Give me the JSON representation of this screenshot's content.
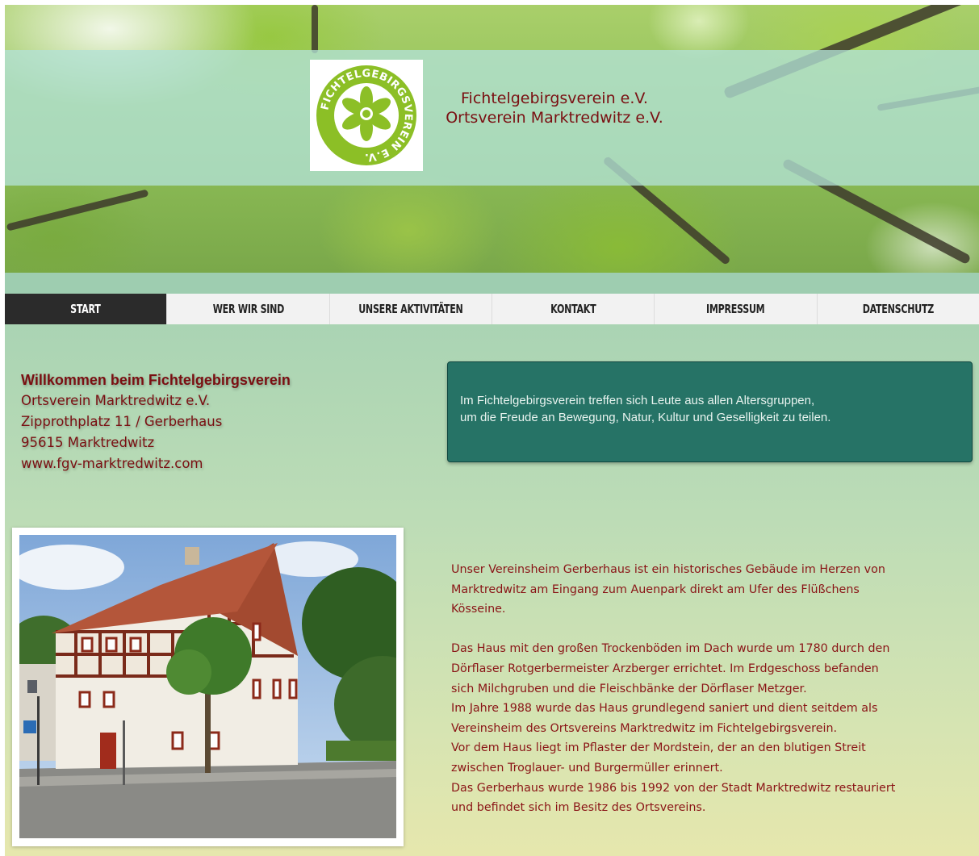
{
  "header": {
    "logo_text": "FICHTELGEBIRGSVEREIN E.V.",
    "org_line1": "Fichtelgebirgsverein e.V.",
    "org_line2": "Ortsverein Marktredwitz e.V."
  },
  "nav": {
    "items": [
      {
        "label": "START",
        "active": true
      },
      {
        "label": "WER WIR SIND",
        "active": false
      },
      {
        "label": "UNSERE AKTIVITÄTEN",
        "active": false
      },
      {
        "label": "KONTAKT",
        "active": false
      },
      {
        "label": "IMPRESSUM",
        "active": false
      },
      {
        "label": "DATENSCHUTZ",
        "active": false
      }
    ]
  },
  "welcome": {
    "title": "Willkommen beim Fichtelgebirgsverein",
    "lines": [
      "Ortsverein Marktredwitz e.V.",
      "Zipprothplatz 11 / Gerberhaus",
      "95615 Marktredwitz",
      "www.fgv-marktredwitz.com"
    ]
  },
  "info_box": {
    "lines": [
      "Im Fichtelgebirgsverein treffen sich Leute aus allen Altersgruppen,",
      "um die Freude an Bewegung, Natur, Kultur und Geselligkeit zu teilen."
    ]
  },
  "description": {
    "para1": [
      "Unser Vereinsheim Gerberhaus ist ein historisches Gebäude im Herzen von",
      "Marktredwitz am Eingang zum Auenpark direkt am Ufer des Flüßchens",
      "Kösseine."
    ],
    "para2": [
      "Das Haus mit den großen Trockenböden im Dach wurde um 1780 durch den",
      "Dörflaser Rotgerbermeister Arzberger errichtet. Im Erdgeschoss befanden",
      "sich Milchgruben und die Fleischbänke der Dörflaser Metzger.",
      "Im Jahre 1988 wurde das Haus grundlegend saniert und dient seitdem als",
      "Vereinsheim des Ortsvereins Marktredwitz im Fichtelgebirgsverein.",
      "Vor dem Haus liegt im Pflaster der Mordstein, der an den blutigen Streit",
      "zwischen Troglauer- und Burgermüller erinnert.",
      "Das Gerberhaus wurde 1986 bis 1992 von der Stadt Marktredwitz restauriert",
      "und befindet sich im Besitz des Ortsvereins."
    ]
  },
  "colors": {
    "accent_red": "#7a0f12",
    "info_box_bg": "#267366",
    "nav_active_bg": "#2b2b2b",
    "logo_green": "#8cbf26"
  }
}
